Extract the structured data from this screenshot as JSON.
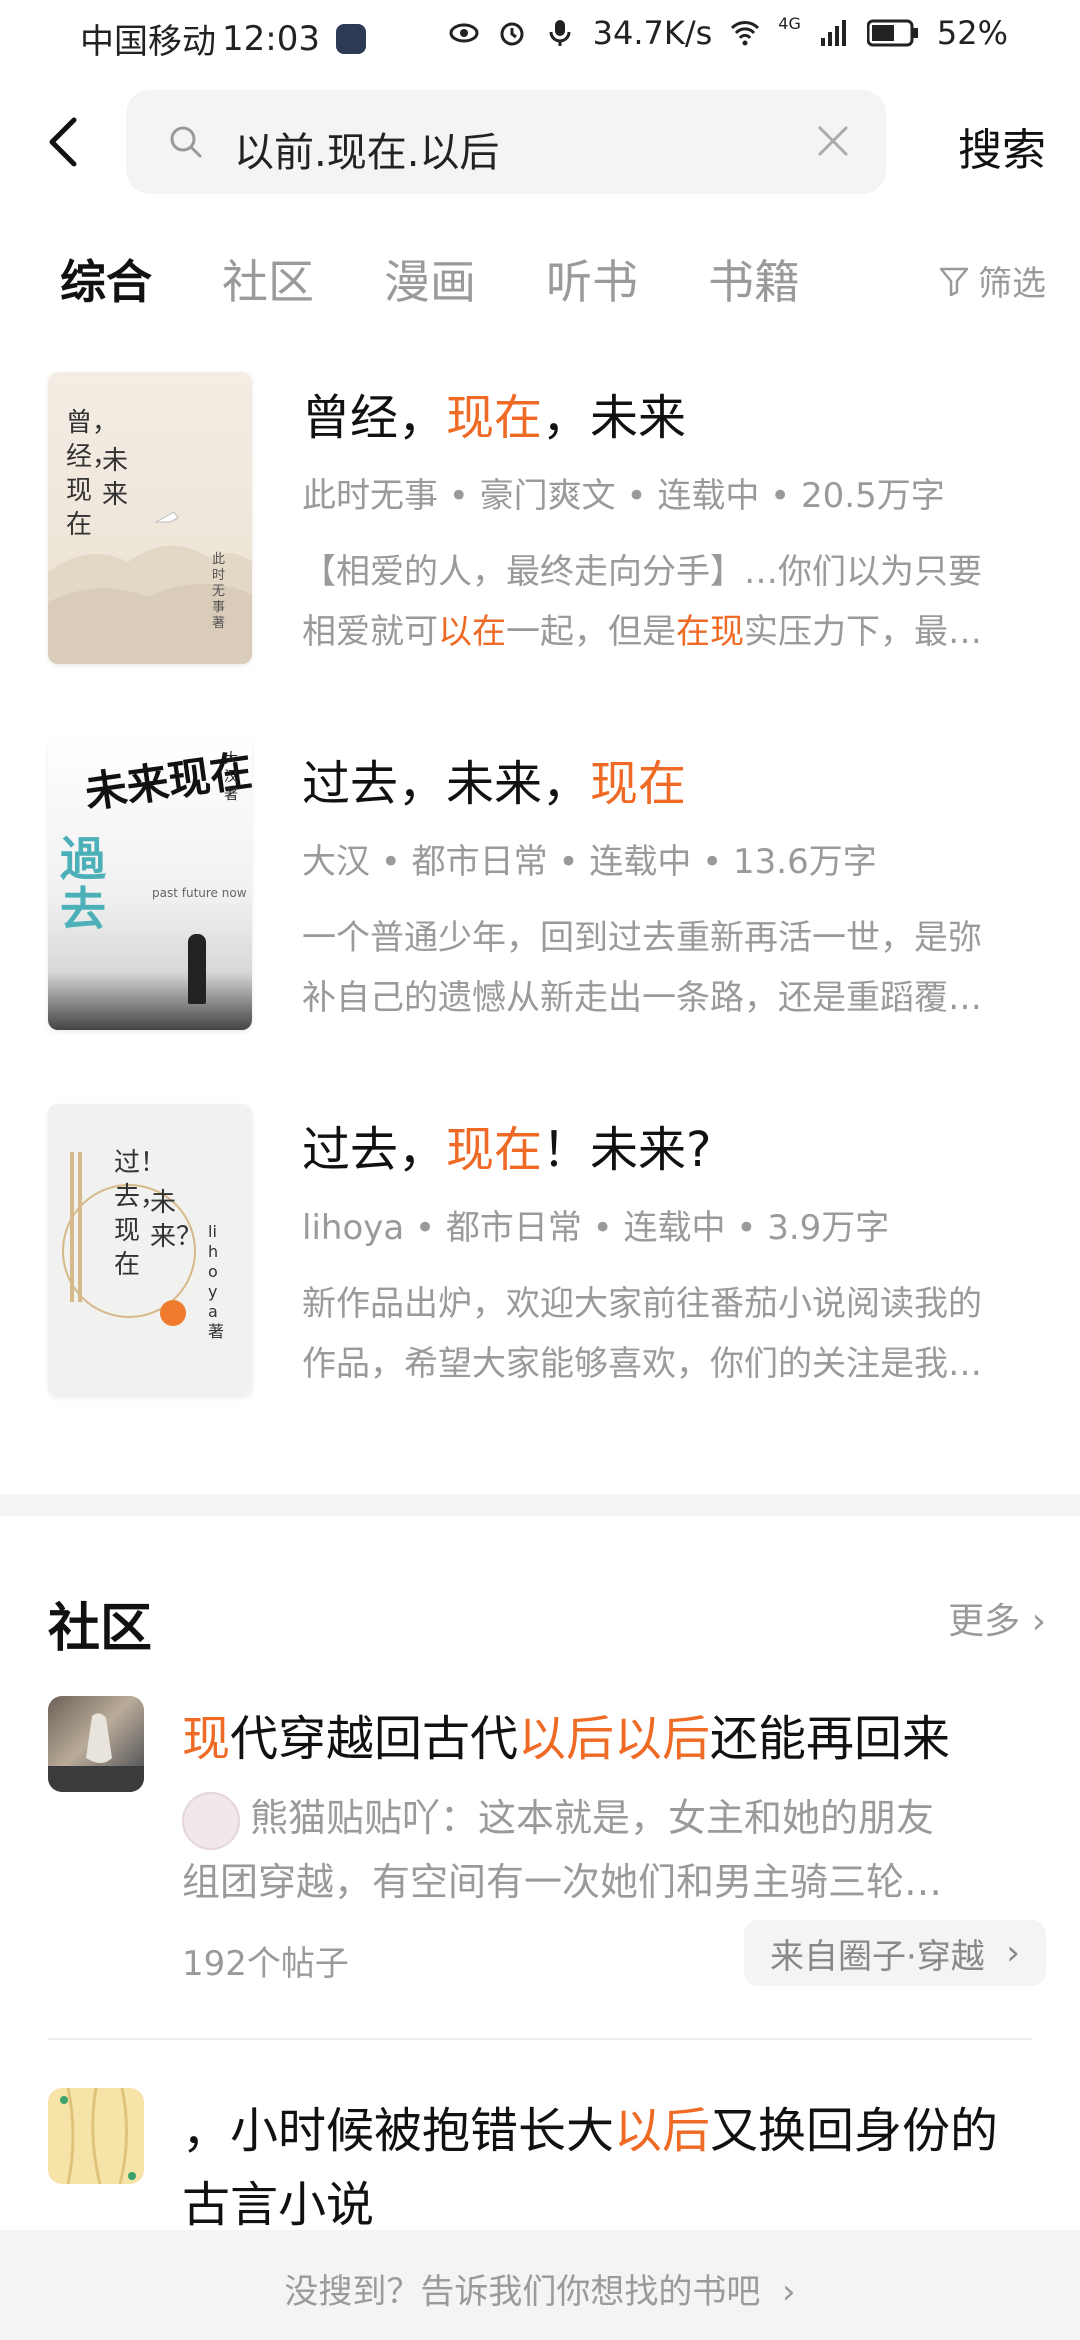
{
  "status_bar": {
    "carrier": "中国移动",
    "time": "12:03",
    "net_speed": "34.7K/s",
    "network": "4G",
    "battery": "52%"
  },
  "search": {
    "query": "以前.现在.以后",
    "button": "搜索"
  },
  "tabs": [
    "综合",
    "社区",
    "漫画",
    "听书",
    "书籍"
  ],
  "filter_label": "筛选",
  "books": [
    {
      "title_parts": [
        {
          "t": "曾经，",
          "hl": false
        },
        {
          "t": "现在",
          "hl": true
        },
        {
          "t": "，未来",
          "hl": false
        }
      ],
      "meta": "此时无事 • 豪门爽文 • 连载中 • 20.5万字",
      "desc_lines": [
        [
          {
            "t": "【相爱的人，最终走向分手】…你们以为只要",
            "hl": false
          }
        ],
        [
          {
            "t": "相爱就可",
            "hl": false
          },
          {
            "t": "以在",
            "hl": true
          },
          {
            "t": "一起，但是",
            "hl": false
          },
          {
            "t": "在现",
            "hl": true
          },
          {
            "t": "实压力下，最…",
            "hl": false
          }
        ]
      ],
      "cover": {
        "text1": "曾，经，现在",
        "text2": "未来",
        "author": "此时无事 著"
      }
    },
    {
      "title_parts": [
        {
          "t": "过去，未来，",
          "hl": false
        },
        {
          "t": "现在",
          "hl": true
        }
      ],
      "meta": "大汉 • 都市日常 • 连载中 • 13.6万字",
      "desc_lines": [
        [
          {
            "t": "一个普通少年，回到过去重新再活一世，是弥",
            "hl": false
          }
        ],
        [
          {
            "t": "补自己的遗憾从新走出一条路，还是重蹈覆…",
            "hl": false
          }
        ]
      ],
      "cover": {
        "big1": "未来现在",
        "big2": "過去",
        "sub": "past future now",
        "author": "大汉 著"
      }
    },
    {
      "title_parts": [
        {
          "t": "过去，",
          "hl": false
        },
        {
          "t": "现在",
          "hl": true
        },
        {
          "t": "！未来?",
          "hl": false
        }
      ],
      "meta": "lihoya • 都市日常 • 连载中 • 3.9万字",
      "desc_lines": [
        [
          {
            "t": "新作品出炉，欢迎大家前往番茄小说阅读我的",
            "hl": false
          }
        ],
        [
          {
            "t": "作品，希望大家能够喜欢，你们的关注是我…",
            "hl": false
          }
        ]
      ],
      "cover": {
        "text1": "过！去，现在",
        "text2": "未来？",
        "author": "lihoya 著"
      }
    }
  ],
  "community": {
    "title": "社区",
    "more": "更多",
    "posts": [
      {
        "title_parts": [
          {
            "t": "现",
            "hl": true
          },
          {
            "t": "代穿越回古代",
            "hl": false
          },
          {
            "t": "以后以后",
            "hl": true
          },
          {
            "t": "还能再回来",
            "hl": false
          }
        ],
        "user": "熊猫贴贴吖",
        "desc_first": "：这本就是，女主和她的朋友",
        "desc_second": "组团穿越，有空间有一次她们和男主骑三轮…",
        "count": "192个帖子",
        "from": "来自圈子·穿越"
      },
      {
        "title_parts": [
          {
            "t": "，小时候被抱错长大",
            "hl": false
          },
          {
            "t": "以后",
            "hl": true
          },
          {
            "t": "又换回身份的古言小说",
            "hl": false
          }
        ]
      }
    ]
  },
  "footer": "没搜到？告诉我们你想找的书吧"
}
